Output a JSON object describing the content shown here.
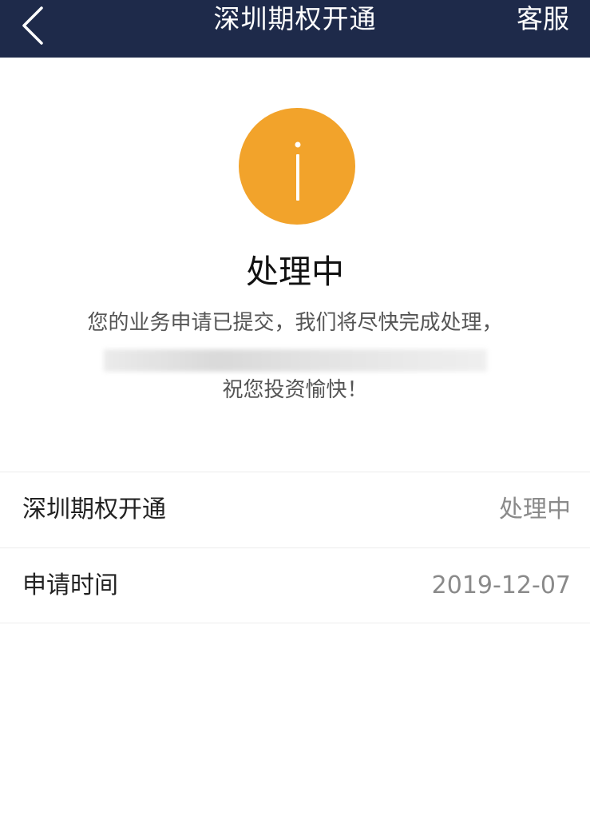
{
  "header": {
    "back_icon": "chevron-left-icon",
    "title": "深圳期权开通",
    "service_label": "客服",
    "background_color": "#1e2a4a"
  },
  "status": {
    "icon": "info-icon",
    "icon_color": "#f2a32b",
    "title": "处理中",
    "message_line1": "您的业务申请已提交，我们将尽快完成处理，",
    "message_line3": "祝您投资愉快！"
  },
  "details": [
    {
      "label": "深圳期权开通",
      "value": "处理中"
    },
    {
      "label": "申请时间",
      "value": "2019-12-07"
    }
  ]
}
